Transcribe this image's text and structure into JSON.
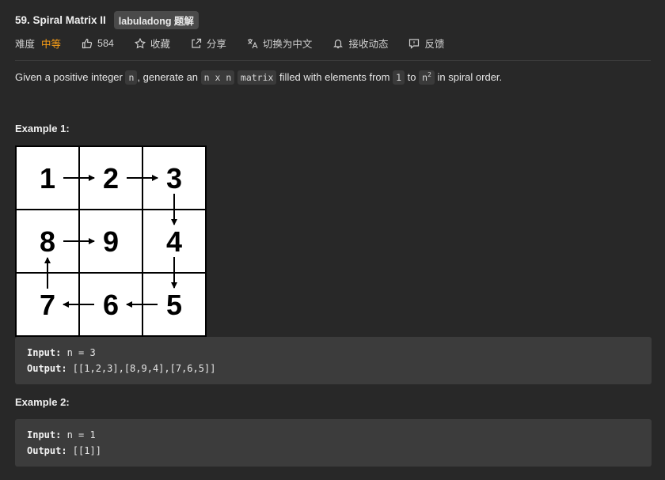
{
  "problem": {
    "title": "59. Spiral Matrix II",
    "badge": "labuladong 题解",
    "difficulty_label": "难度",
    "difficulty": "中等",
    "likes": "584",
    "favorite": "收藏",
    "share": "分享",
    "translate": "切换为中文",
    "subscribe": "接收动态",
    "feedback": "反馈"
  },
  "description": {
    "p1": "Given a positive integer ",
    "c1": "n",
    "p2": ", generate an ",
    "c2": "n x n",
    "p3": " ",
    "c3": "matrix",
    "p4": " filled with elements from ",
    "c4": "1",
    "p5": " to ",
    "c5_base": "n",
    "c5_sup": "2",
    "p6": " in spiral order."
  },
  "example1": {
    "title": "Example 1:",
    "matrix": [
      [
        "1",
        "2",
        "3"
      ],
      [
        "8",
        "9",
        "4"
      ],
      [
        "7",
        "6",
        "5"
      ]
    ],
    "input_label": "Input:",
    "input_value": " n = 3",
    "output_label": "Output:",
    "output_value": " [[1,2,3],[8,9,4],[7,6,5]]"
  },
  "example2": {
    "title": "Example 2:",
    "input_label": "Input:",
    "input_value": " n = 1",
    "output_label": "Output:",
    "output_value": " [[1]]"
  },
  "colors": {
    "background": "#282828",
    "difficulty": "#ffa116",
    "code_bg": "#3c3c3c"
  },
  "icons": {
    "likes": "thumbs-up-icon",
    "favorite": "star-icon",
    "share": "share-icon",
    "translate": "translate-icon",
    "subscribe": "bell-icon",
    "feedback": "feedback-icon"
  }
}
